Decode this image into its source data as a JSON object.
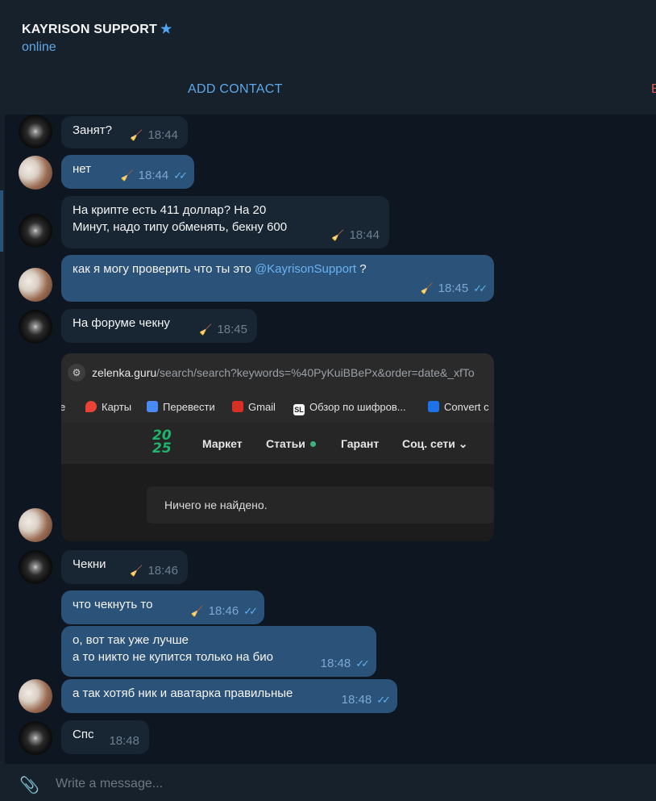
{
  "header": {
    "title": "KAYRISON SUPPORT",
    "verified_icon": "★",
    "status": "online",
    "add_contact": "ADD CONTACT",
    "edge_fragment": "B"
  },
  "messages": [
    {
      "text": "Занят?",
      "time": "18:44",
      "outgoing": false
    },
    {
      "text": "нет",
      "time": "18:44",
      "outgoing": true
    },
    {
      "text": "На крипте есть 411 доллар? На 20\nМинут, надо типу обменять, бекну 600",
      "time": "18:44",
      "outgoing": false
    },
    {
      "text_before": "как я могу проверить что ты это ",
      "mention": "@KayrisonSupport",
      "text_after": " ?",
      "time": "18:45",
      "outgoing": true
    },
    {
      "text": "На форуме чекну",
      "time": "18:45",
      "outgoing": false
    },
    {
      "text": "Чекни",
      "time": "18:46",
      "outgoing": false
    },
    {
      "text": "что чекнуть то",
      "time": "18:46",
      "outgoing": true
    },
    {
      "text": "о, вот так уже лучше\nа то никто не купится только на био",
      "time": "18:48",
      "outgoing": true
    },
    {
      "text": "а так хотяб ник и аватарка правильные",
      "time": "18:48",
      "outgoing": true
    },
    {
      "text": "Спс",
      "time": "18:48",
      "outgoing": false
    }
  ],
  "screenshot": {
    "url_host": "zelenka.guru",
    "url_path": "/search/search?keywords=%40PyKuiBBePx&order=date&_xfTo",
    "bookmarks": [
      "е",
      "Карты",
      "Перевести",
      "Gmail",
      "Обзор по шифров...",
      "Convert c"
    ],
    "bookmark_icons": {
      "maps": "#ea4335",
      "translate": "#4a8af4",
      "gmail": "#d93025",
      "sl": "#f5f5f5",
      "convert": "#1a73e8"
    },
    "bookmark_sl_label": "SL",
    "logo": "20\n25",
    "nav": [
      "Маркет",
      "Статьи",
      "Гарант",
      "Соц. сети"
    ],
    "nav_chevron": "⌄",
    "empty_result": "Ничего не найдено."
  },
  "composer": {
    "placeholder": "Write a message..."
  },
  "icons": {
    "broom": "🧹",
    "double_check": "✓✓",
    "attach": "📎"
  }
}
